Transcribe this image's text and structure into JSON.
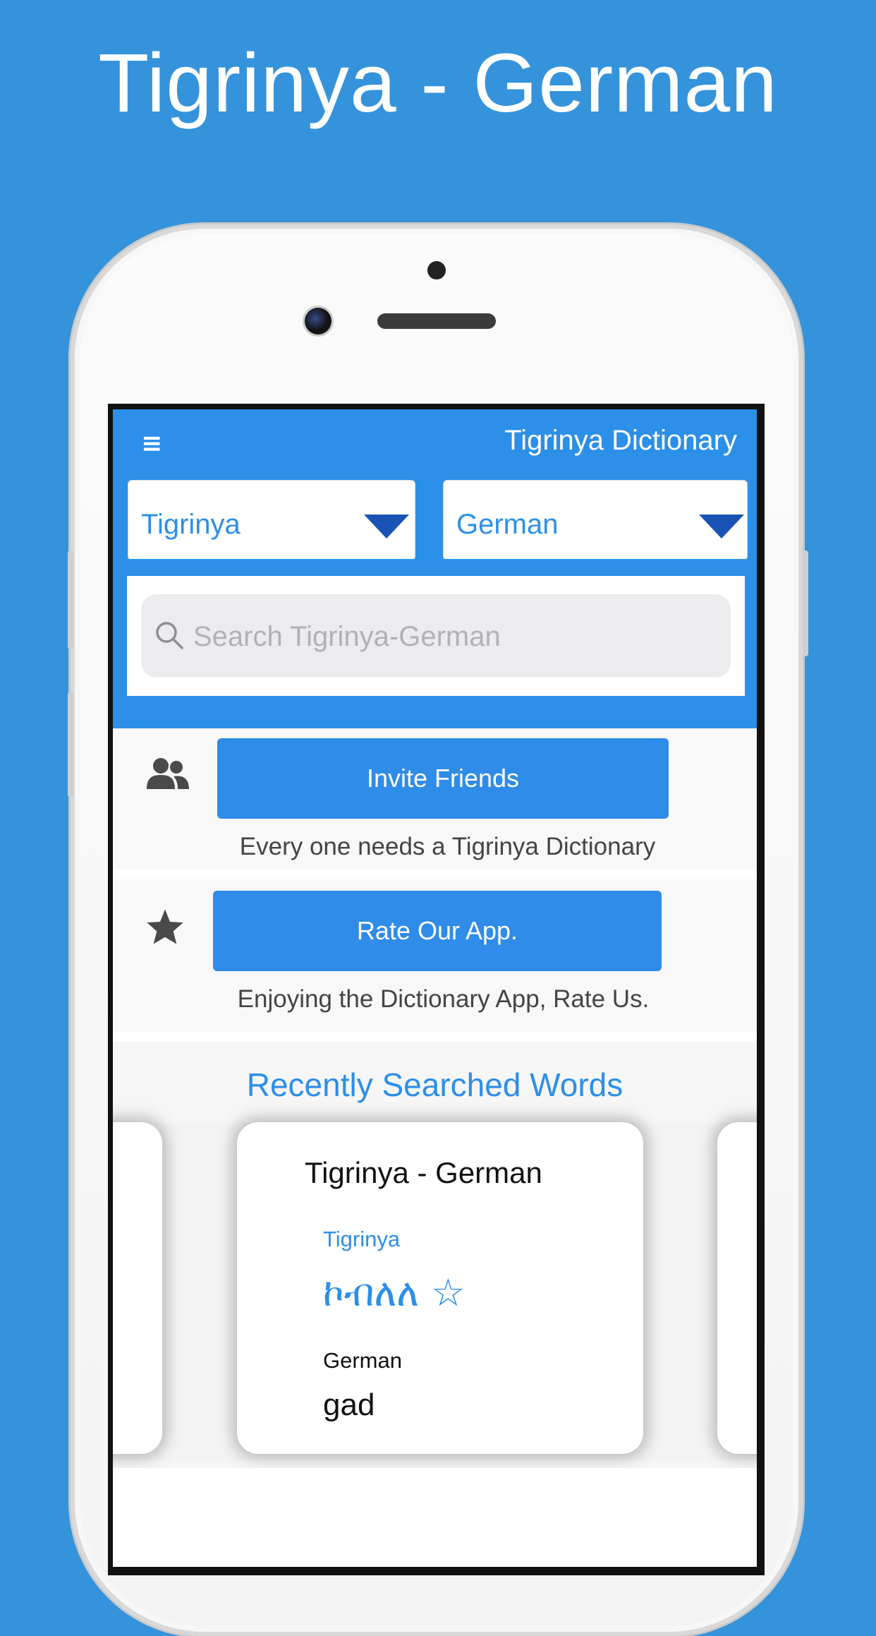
{
  "headline": "Tigrinya - German",
  "app": {
    "nav_title": "Tigrinya Dictionary",
    "menu_icon": "menu-icon"
  },
  "languages": {
    "source": "Tigrinya",
    "target": "German"
  },
  "search": {
    "placeholder": "Search Tigrinya-German"
  },
  "invite": {
    "button_label": "Invite Friends",
    "caption": "Every one needs a Tigrinya Dictionary",
    "icon": "users-icon"
  },
  "rate": {
    "button_label": "Rate Our App.",
    "caption": "Enjoying the Dictionary App, Rate Us.",
    "icon": "star-icon"
  },
  "recent": {
    "title": "Recently Searched Words",
    "card": {
      "title": "Tigrinya - German",
      "source_lang": "Tigrinya",
      "source_word": "ኮብለለ ☆",
      "target_lang": "German",
      "target_word": "gad"
    }
  },
  "colors": {
    "background": "#3593dc",
    "primary": "#2c8fe8",
    "dropdown_arrow": "#1953b4"
  }
}
